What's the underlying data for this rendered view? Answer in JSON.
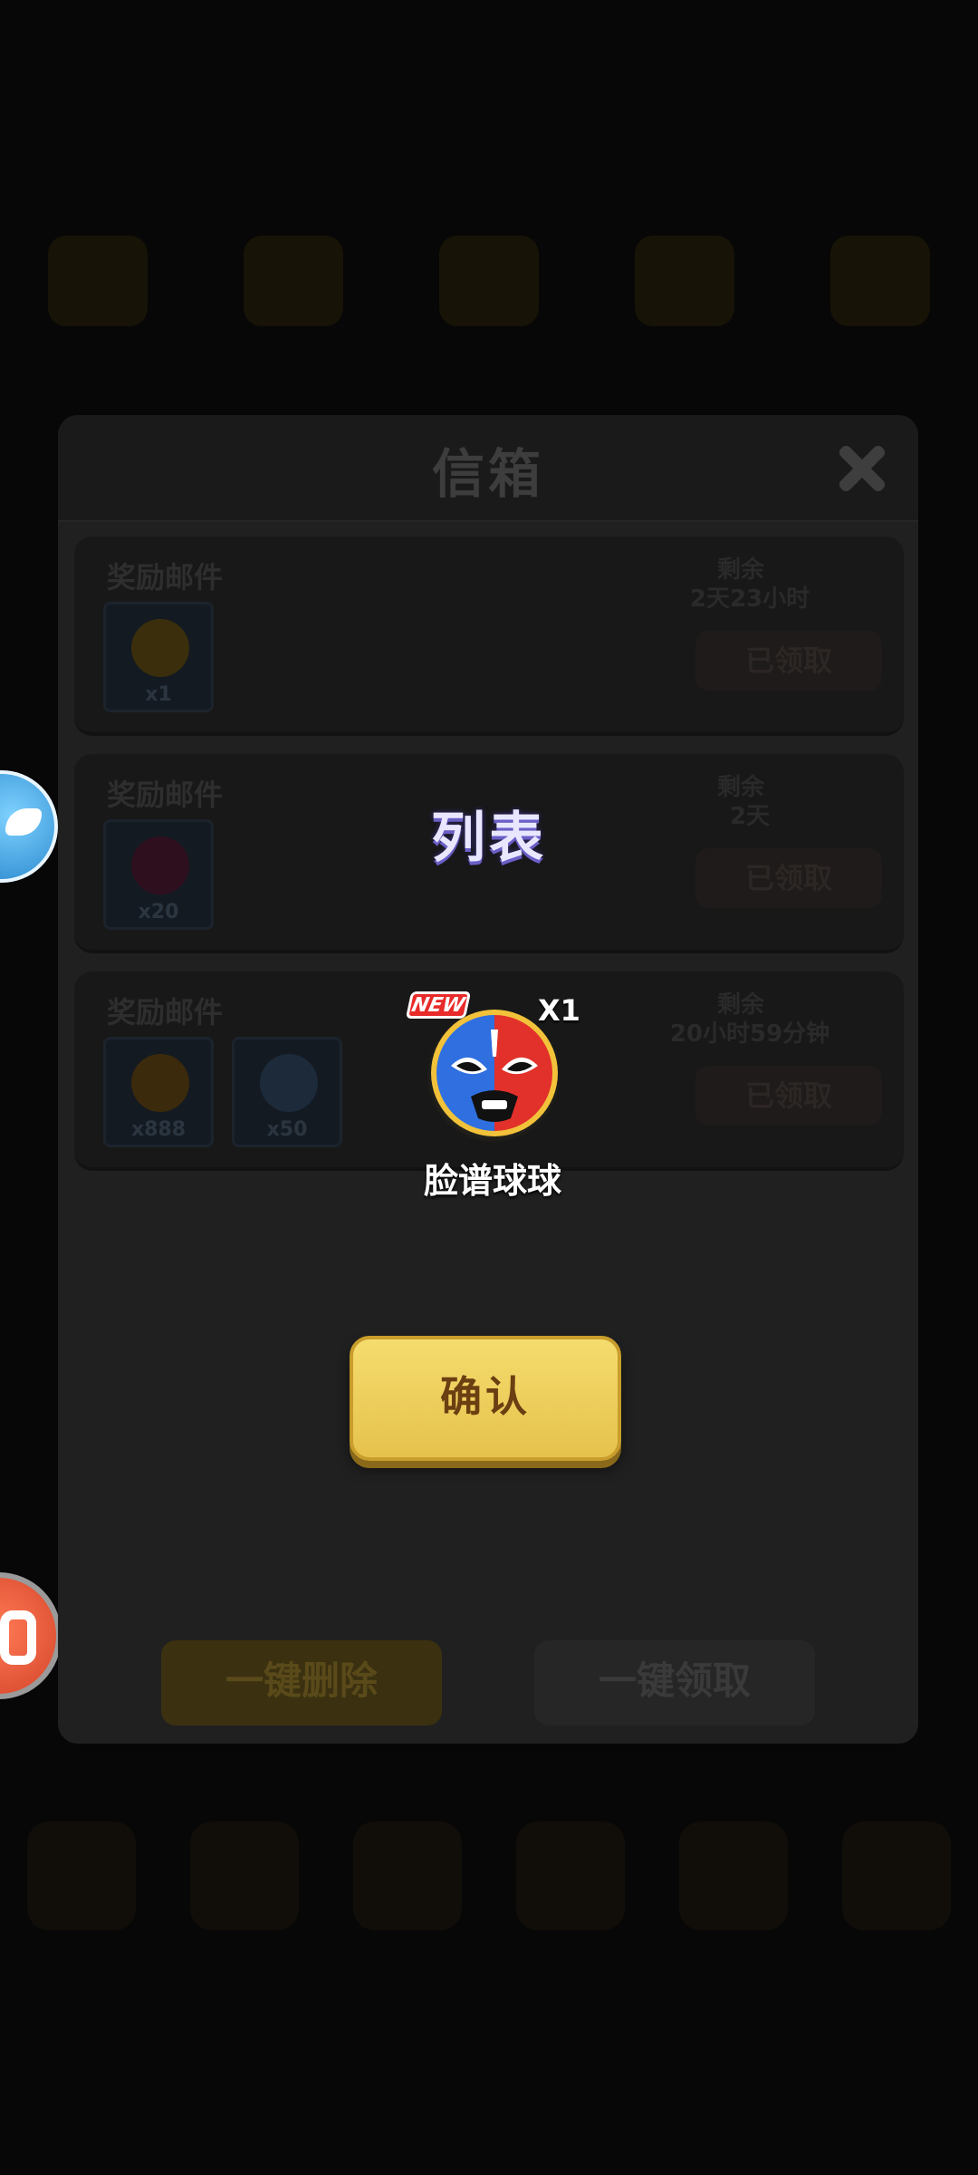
{
  "mailbox": {
    "title": "信箱",
    "mails": [
      {
        "title": "奖励邮件",
        "remain_label": "剩余",
        "remain_value": "2天23小时",
        "status": "已领取",
        "items": [
          {
            "qty": "x1",
            "color": "#d6a51a"
          }
        ]
      },
      {
        "title": "奖励邮件",
        "remain_label": "剩余",
        "remain_value": "2天",
        "status": "已领取",
        "items": [
          {
            "qty": "x20",
            "color": "#a3245a"
          }
        ]
      },
      {
        "title": "奖励邮件",
        "remain_label": "剩余",
        "remain_value": "20小时59分钟",
        "status": "已领取",
        "items": [
          {
            "qty": "x888",
            "color": "#e0a326"
          },
          {
            "qty": "x50",
            "color": "#6a8ab4"
          }
        ]
      }
    ],
    "delete_all_label": "一键删除",
    "claim_all_label": "一键领取"
  },
  "popup": {
    "title": "列表",
    "reward": {
      "badge": "NEW",
      "quantity": "X1",
      "name": "脸谱球球",
      "icon": "opera-mask-ball-icon"
    },
    "confirm_label": "确认"
  },
  "colors": {
    "confirm_button": "#f0d05c",
    "new_badge": "#e82a2a",
    "overlay": "#070707"
  }
}
